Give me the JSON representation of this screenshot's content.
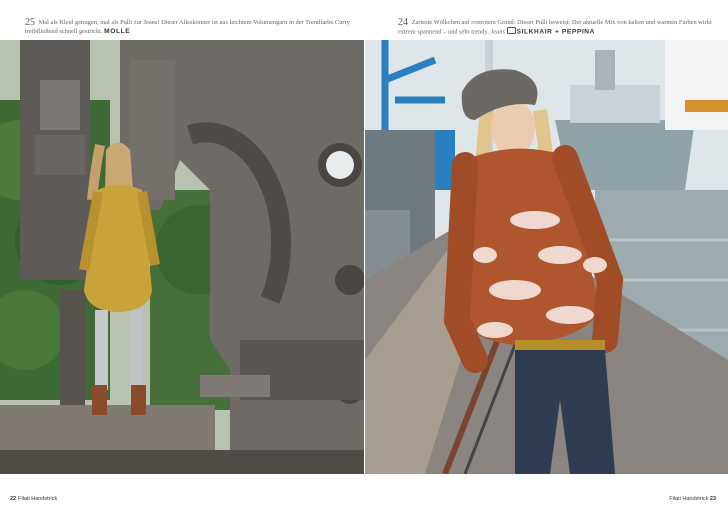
{
  "left_page": {
    "caption": {
      "number": "25",
      "text": "Mal als Kleid getragen, mal als Pulli zur Jeans! Dieser Alleskönner ist aus leichtem Volumengarn in der Trendfarbe Curry treibfließend schnell gestrickt.",
      "brand": "MOLLE"
    },
    "folio": {
      "page_number": "22",
      "magazine": "Filati Handstrick"
    }
  },
  "right_page": {
    "caption": {
      "number": "24",
      "text": "Zarteste Wölkchen auf rostrotem Grund: Dieser Pulli beweist: Der aktuelle Mix von kalten und warmen Farben wirkt extrem spannend – und sehr trendy.",
      "brand_prefix": "Jeans",
      "brand": "SILKHAIR + PEPPINA"
    },
    "folio": {
      "page_number": "23",
      "magazine": "Filati Handstrick"
    }
  },
  "colors": {
    "curry_sweater": "#c9a23a",
    "rust_sweater": "#b0562e",
    "machinery": "#6e6a66",
    "foliage": "#3f6a35",
    "harbor_sky": "#dfe6ea",
    "crane_blue": "#2a7fc0"
  }
}
